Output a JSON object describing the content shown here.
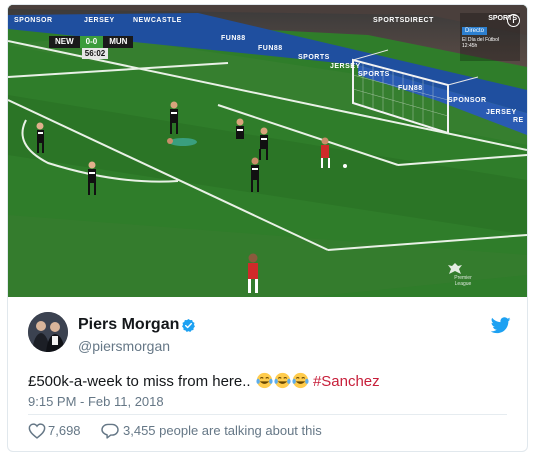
{
  "scorebug": {
    "home": "NEW",
    "score": "0-0",
    "away": "MUN",
    "clock": "56:02"
  },
  "broadcast": {
    "channel": "SPORTS",
    "live": "Directo",
    "program": "El Día del Fútbol",
    "program_time": "12:45h",
    "league": "Premier League"
  },
  "ads": [
    "SPONSOR",
    "JERSEY",
    "NEWCASTLE",
    "FUN88",
    "FUN88",
    "SPORTS",
    "JERSEY",
    "SPORTSDIRECT",
    "SPORTS",
    "FUN88",
    "SPONSOR",
    "JERSEY",
    "RE"
  ],
  "tweet": {
    "author_name": "Piers Morgan",
    "author_handle": "@piersmorgan",
    "text": "£500k-a-week to miss from here..",
    "hashtag": "#Sanchez",
    "timestamp": "9:15 PM - Feb 11, 2018",
    "likes": "7,698",
    "talking": "3,455 people are talking about this"
  },
  "icons": [
    "verified-icon",
    "twitter-bird-icon",
    "heart-icon",
    "comment-icon",
    "info-icon",
    "tears-of-joy-emoji"
  ],
  "colors": {
    "pitch": "#2f7d2a",
    "hashtag": "#c71f3a",
    "verified": "#1da1f2",
    "muted": "#657786"
  }
}
